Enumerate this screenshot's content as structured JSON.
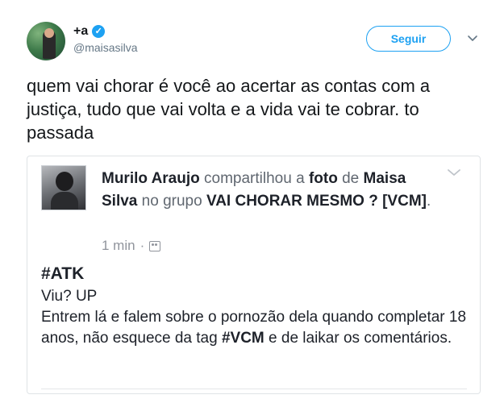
{
  "tweet": {
    "display_name": "+a",
    "handle": "@maisasilva",
    "follow_label": "Seguir",
    "text": "quem vai chorar é você ao acertar as contas com a justiça, tudo que vai volta e a vida vai te cobrar. to passada"
  },
  "fb_post": {
    "author": "Murilo Araujo",
    "shared_text": "compartilhou a",
    "photo_word": "foto",
    "of_word": "de",
    "photo_owner": "Maisa Silva",
    "group_prefix": "no grupo",
    "group_name": "VAI CHORAR MESMO ? [VCM]",
    "period": ".",
    "time": "1 min",
    "separator": "·",
    "hashtag_title": "#ATK",
    "line1": "Viu? UP",
    "line2_pre": "Entrem lá e falem sobre o pornozão dela quando completar 18 anos, não esquece da tag ",
    "line2_tag": "#VCM",
    "line2_post": " e de laikar os comentários."
  },
  "colors": {
    "twitter_blue": "#1da1f2",
    "handle_gray": "#657786",
    "fb_text": "#1d2129",
    "fb_meta": "#90949c"
  },
  "icons": {
    "verified": "verified-badge-icon",
    "caret": "chevron-down-icon",
    "fb_menu": "chevron-down-icon",
    "group": "group-icon"
  }
}
